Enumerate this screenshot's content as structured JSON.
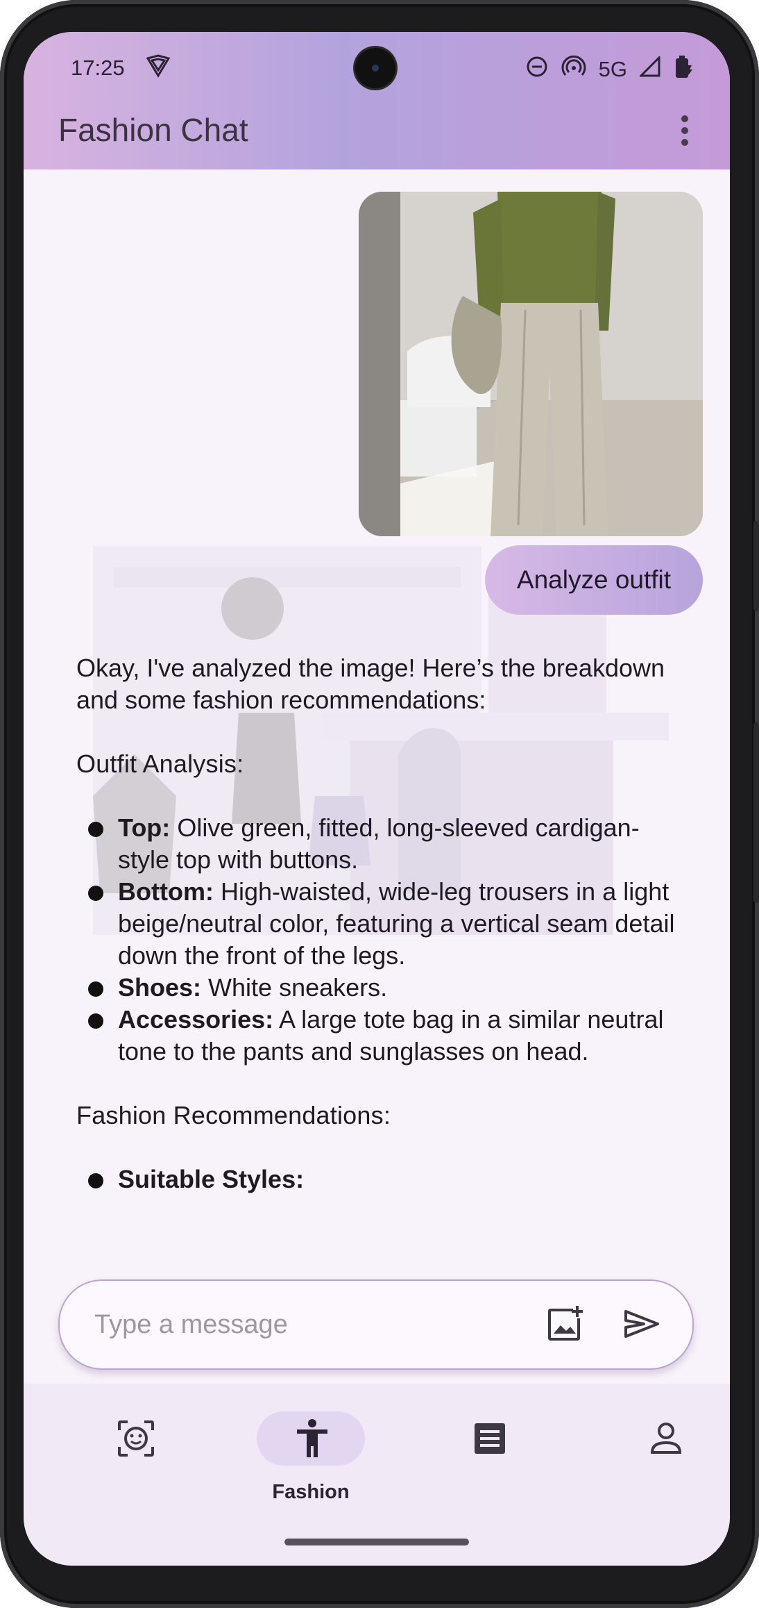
{
  "status_bar": {
    "time": "17:25",
    "network": "5G",
    "icons": [
      "vpn-icon",
      "do-not-disturb-icon",
      "hotspot-icon",
      "signal-icon",
      "battery-charging-icon"
    ]
  },
  "app_bar": {
    "title": "Fashion Chat",
    "menu_icon": "more-vert-icon"
  },
  "chat": {
    "user_image_alt": "outfit photo",
    "user_message": "Analyze outfit",
    "reply": {
      "intro": "Okay, I've analyzed the image! Here’s the breakdown and some fashion recommendations:",
      "section1_title": "Outfit Analysis:",
      "items": [
        {
          "label": "Top:",
          "text": "Olive green, fitted, long-sleeved cardigan-style top with buttons."
        },
        {
          "label": "Bottom:",
          "text": "High-waisted, wide-leg trousers in a light beige/neutral color, featuring a vertical seam detail down the front of the legs."
        },
        {
          "label": "Shoes:",
          "text": "White sneakers."
        },
        {
          "label": "Accessories:",
          "text": "A large tote bag in a similar neutral tone to the pants and sunglasses on head."
        }
      ],
      "section2_title": "Fashion Recommendations:",
      "items2": [
        {
          "label": "Suitable Styles:",
          "text": ""
        }
      ]
    }
  },
  "composer": {
    "placeholder": "Type a message",
    "add_image_icon": "add-photo-icon",
    "send_icon": "send-icon"
  },
  "bottom_nav": {
    "items": [
      {
        "icon": "face-scan-icon",
        "label": ""
      },
      {
        "icon": "accessibility-icon",
        "label": "Fashion"
      },
      {
        "icon": "document-icon",
        "label": ""
      },
      {
        "icon": "person-icon",
        "label": ""
      }
    ],
    "active_index": 1
  },
  "colors": {
    "appbar_gradient": [
      "#d8b3e0",
      "#b3a3dd",
      "#c49bd8"
    ],
    "background": "#f8f2fa",
    "bubble_gradient": [
      "#d7b9e6",
      "#b7a4dc"
    ],
    "nav_background": "#f1e9f5",
    "nav_active_pill": "#e2d6f0"
  }
}
